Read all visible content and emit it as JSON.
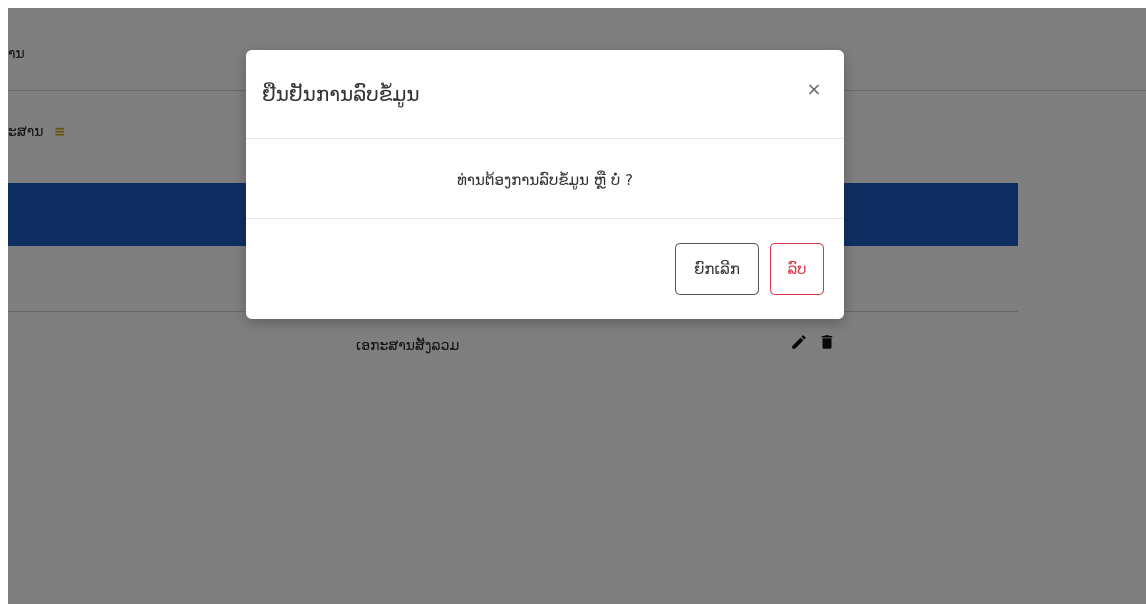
{
  "background": {
    "header_title": "ານ",
    "section_title": "ະສານ",
    "section_menu_icon": "≡",
    "row_label": "ເອກະສານສັງລວມ"
  },
  "modal": {
    "title": "ຢືນຢັນການລົບຂໍ້ມູນ",
    "close_symbol": "×",
    "message": "ທ່ານຕ້ອງການລົບຂໍ້ມູນ ຫຼື ບໍ່ ?",
    "cancel_label": "ຍົກເລີກ",
    "delete_label": "ລົບ"
  },
  "colors": {
    "table_header": "#1f5fc6",
    "overlay": "rgba(0,0,0,0.5)",
    "delete_accent": "#dc3545"
  }
}
